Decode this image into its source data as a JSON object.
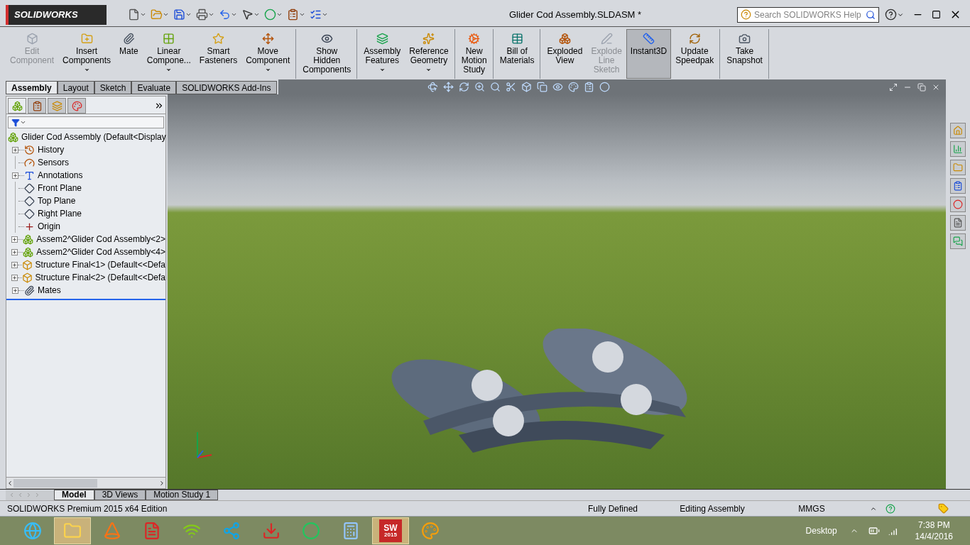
{
  "title_bar": {
    "logo": "SOLIDWORKS",
    "title": "Glider Cod Assembly.SLDASM *",
    "search": {
      "placeholder": "Search SOLIDWORKS Help"
    }
  },
  "ribbon": {
    "groups": [
      [
        {
          "kind": "edit",
          "lines": [
            "Edit",
            "Component"
          ],
          "disabled": true,
          "selected": false,
          "dropdown": false
        },
        {
          "kind": "insert",
          "lines": [
            "Insert",
            "Components"
          ],
          "disabled": false,
          "selected": false,
          "dropdown": true
        },
        {
          "kind": "mate",
          "lines": [
            "Mate"
          ],
          "disabled": false,
          "selected": false,
          "dropdown": false
        },
        {
          "kind": "linear",
          "lines": [
            "Linear",
            "Compone..."
          ],
          "disabled": false,
          "selected": false,
          "dropdown": true
        },
        {
          "kind": "fasteners",
          "lines": [
            "Smart",
            "Fasteners"
          ],
          "disabled": false,
          "selected": false,
          "dropdown": false
        },
        {
          "kind": "move",
          "lines": [
            "Move",
            "Component"
          ],
          "disabled": false,
          "selected": false,
          "dropdown": true
        }
      ],
      [
        {
          "kind": "hidden",
          "lines": [
            "Show",
            "Hidden",
            "Components"
          ],
          "disabled": false,
          "selected": false,
          "dropdown": false
        }
      ],
      [
        {
          "kind": "features",
          "lines": [
            "Assembly",
            "Features"
          ],
          "disabled": false,
          "selected": false,
          "dropdown": true
        },
        {
          "kind": "reference",
          "lines": [
            "Reference",
            "Geometry"
          ],
          "disabled": false,
          "selected": false,
          "dropdown": true
        }
      ],
      [
        {
          "kind": "motion",
          "lines": [
            "New",
            "Motion",
            "Study"
          ],
          "disabled": false,
          "selected": false,
          "dropdown": false
        }
      ],
      [
        {
          "kind": "bom",
          "lines": [
            "Bill of",
            "Materials"
          ],
          "disabled": false,
          "selected": false,
          "dropdown": false
        }
      ],
      [
        {
          "kind": "exploded",
          "lines": [
            "Exploded",
            "View"
          ],
          "disabled": false,
          "selected": false,
          "dropdown": false
        },
        {
          "kind": "explodeline",
          "lines": [
            "Explode",
            "Line",
            "Sketch"
          ],
          "disabled": true,
          "selected": false,
          "dropdown": false
        },
        {
          "kind": "instant3d",
          "lines": [
            "Instant3D"
          ],
          "disabled": false,
          "selected": true,
          "dropdown": false
        },
        {
          "kind": "speedpak",
          "lines": [
            "Update",
            "Speedpak"
          ],
          "disabled": false,
          "selected": false,
          "dropdown": false
        }
      ],
      [
        {
          "kind": "snapshot",
          "lines": [
            "Take",
            "Snapshot"
          ],
          "disabled": false,
          "selected": false,
          "dropdown": false
        }
      ]
    ]
  },
  "command_tabs": [
    {
      "label": "Assembly",
      "selected": true
    },
    {
      "label": "Layout",
      "selected": false
    },
    {
      "label": "Sketch",
      "selected": false
    },
    {
      "label": "Evaluate",
      "selected": false
    },
    {
      "label": "SOLIDWORKS Add-Ins",
      "selected": false
    }
  ],
  "panel_tabs": [
    {
      "selected": true
    },
    {
      "selected": false
    },
    {
      "selected": false
    },
    {
      "selected": false
    }
  ],
  "tree": {
    "root": "Glider Cod Assembly  (Default<Display",
    "items": [
      {
        "kind": "history",
        "label": "History",
        "expandable": true
      },
      {
        "kind": "sensors",
        "label": "Sensors",
        "expandable": false
      },
      {
        "kind": "annotations",
        "label": "Annotations",
        "expandable": true
      },
      {
        "kind": "plane",
        "label": "Front Plane",
        "expandable": false
      },
      {
        "kind": "plane",
        "label": "Top Plane",
        "expandable": false
      },
      {
        "kind": "plane",
        "label": "Right Plane",
        "expandable": false
      },
      {
        "kind": "origin",
        "label": "Origin",
        "expandable": false
      },
      {
        "kind": "assembly",
        "label": "Assem2^Glider Cod Assembly<2>",
        "expandable": true
      },
      {
        "kind": "assembly",
        "label": "Assem2^Glider Cod Assembly<4>",
        "expandable": true
      },
      {
        "kind": "part",
        "label": "Structure Final<1>  (Default<<Defa",
        "expandable": true
      },
      {
        "kind": "part",
        "label": "Structure Final<2>  (Default<<Defa",
        "expandable": true
      },
      {
        "kind": "mates",
        "label": "Mates",
        "expandable": true
      }
    ]
  },
  "bottom_tabs": [
    {
      "label": "Model",
      "selected": true
    },
    {
      "label": "3D Views",
      "selected": false
    },
    {
      "label": "Motion Study 1",
      "selected": false
    }
  ],
  "status_bar": {
    "edition": "SOLIDWORKS Premium 2015 x64 Edition",
    "items": [
      "Fully Defined",
      "Editing Assembly",
      "MMGS"
    ]
  },
  "taskbar": {
    "apps": [
      {
        "kind": "browser-e",
        "selected": false
      },
      {
        "kind": "folder",
        "selected": true
      },
      {
        "kind": "cone",
        "selected": false
      },
      {
        "kind": "pdf",
        "selected": false
      },
      {
        "kind": "network",
        "selected": false
      },
      {
        "kind": "share",
        "selected": false
      },
      {
        "kind": "download",
        "selected": false
      },
      {
        "kind": "chrome",
        "selected": false
      },
      {
        "kind": "calculator",
        "selected": false
      },
      {
        "kind": "solidworks",
        "selected": true,
        "label": "SW",
        "badge": "2015"
      },
      {
        "kind": "paint",
        "selected": false
      }
    ],
    "desktop": "Desktop",
    "time": "7:38 PM",
    "date": "14/4/2016"
  }
}
